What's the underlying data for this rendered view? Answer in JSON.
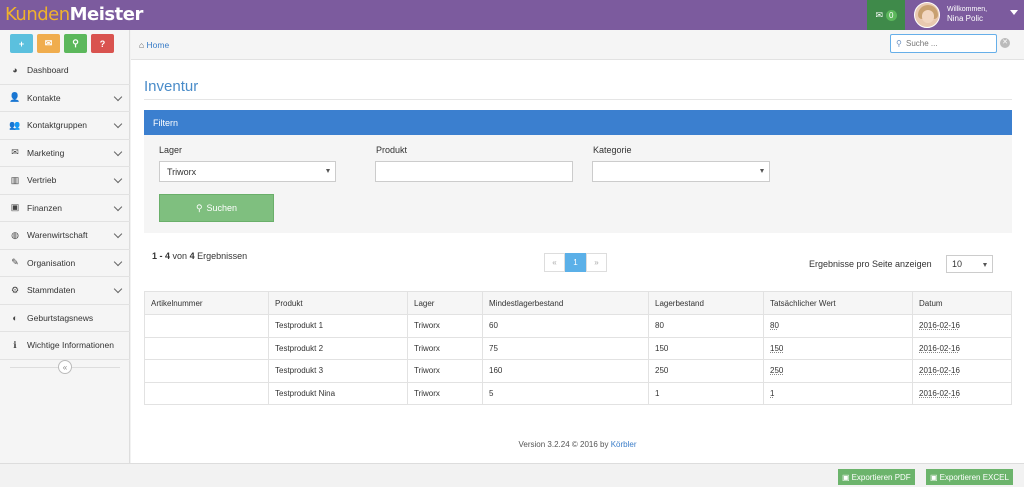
{
  "app": {
    "logo_part1": "Kunden",
    "logo_part2": "Meister",
    "notification_count": "0",
    "welcome": "Willkommen,",
    "username": "Nina Polic"
  },
  "quick_buttons": [
    {
      "glyph": "+",
      "color": "#5bc0de"
    },
    {
      "glyph": "✉",
      "color": "#f0ad4e"
    },
    {
      "glyph": "⚲",
      "color": "#5cb85c"
    },
    {
      "glyph": "?",
      "color": "#d9534f"
    }
  ],
  "sidebar": {
    "items": [
      {
        "label": "Dashboard",
        "icon": "dashboard-icon",
        "glyph": "◕"
      },
      {
        "label": "Kontakte",
        "icon": "user-icon",
        "glyph": "👤"
      },
      {
        "label": "Kontaktgruppen",
        "icon": "users-icon",
        "glyph": "👥"
      },
      {
        "label": "Marketing",
        "icon": "envelope-icon",
        "glyph": "✉"
      },
      {
        "label": "Vertrieb",
        "icon": "bar-chart-icon",
        "glyph": "▥"
      },
      {
        "label": "Finanzen",
        "icon": "money-icon",
        "glyph": "▣"
      },
      {
        "label": "Warenwirtschaft",
        "icon": "globe-icon",
        "glyph": "◍"
      },
      {
        "label": "Organisation",
        "icon": "edit-icon",
        "glyph": "✎"
      },
      {
        "label": "Stammdaten",
        "icon": "cogs-icon",
        "glyph": "⚙"
      },
      {
        "label": "Geburtstagsnews",
        "icon": "contrast-icon",
        "glyph": "◐"
      },
      {
        "label": "Wichtige Informationen",
        "icon": "info-icon",
        "glyph": "ℹ"
      }
    ],
    "collapse_glyph": "«"
  },
  "breadcrumb": {
    "home": "Home"
  },
  "search": {
    "placeholder": "Suche ..."
  },
  "page": {
    "title": "Inventur"
  },
  "filter": {
    "header": "Filtern",
    "lager_label": "Lager",
    "lager_value": "Triworx",
    "produkt_label": "Produkt",
    "produkt_value": "",
    "kategorie_label": "Kategorie",
    "kategorie_value": "",
    "search_button": "Suchen"
  },
  "results": {
    "range": "1 - 4",
    "of": "von",
    "total": "4",
    "suffix": "Ergebnissen",
    "pager_prev": "«",
    "pager_current": "1",
    "pager_next": "»",
    "per_page_label": "Ergebnisse pro Seite anzeigen",
    "per_page_value": "10"
  },
  "table": {
    "columns": [
      "Artikelnummer",
      "Produkt",
      "Lager",
      "Mindestlagerbestand",
      "Lagerbestand",
      "Tatsächlicher Wert",
      "Datum"
    ],
    "rows": [
      [
        "",
        "Testprodukt 1",
        "Triworx",
        "60",
        "80",
        "80",
        "2016-02-16"
      ],
      [
        "",
        "Testprodukt 2",
        "Triworx",
        "75",
        "150",
        "150",
        "2016-02-16"
      ],
      [
        "",
        "Testprodukt 3",
        "Triworx",
        "160",
        "250",
        "250",
        "2016-02-16"
      ],
      [
        "",
        "Testprodukt Nina",
        "Triworx",
        "5",
        "1",
        "1",
        "2016-02-16"
      ]
    ]
  },
  "footer": {
    "version": "Version 3.2.24 © 2016 by",
    "company": "Körbler",
    "export_pdf": "Exportieren PDF",
    "export_excel": "Exportieren EXCEL"
  }
}
